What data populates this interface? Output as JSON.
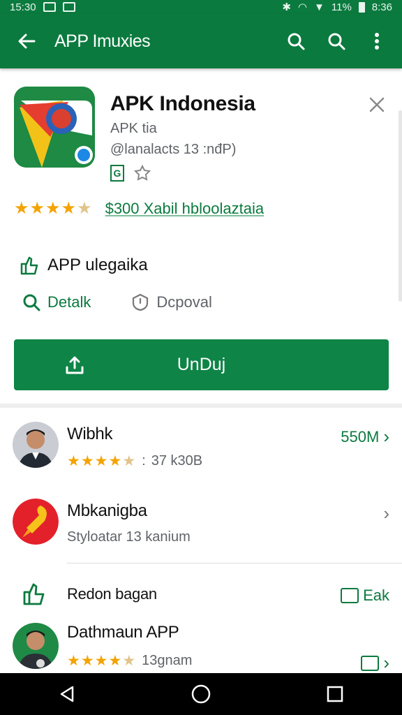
{
  "status_bar": {
    "time": "15:30",
    "battery": "11%",
    "clock_right": "8:36"
  },
  "app_bar": {
    "title": "APP Imuxies"
  },
  "app": {
    "name": "APK Indonesia",
    "developer": "APK tia",
    "meta": "@lanalacts 13 :nđP)",
    "rating_stars": 4,
    "price_text": "$300 Xabil hbloolaztaia",
    "feature_text": "APP ulegaika",
    "detail_link": "Detalk",
    "report_link": "Dcpoval",
    "install_label": "UnDuj"
  },
  "list": {
    "items": [
      {
        "title": "Wibhk",
        "sub": "37 k30B",
        "stars": 4.5,
        "right": "550M"
      },
      {
        "title": "Mbkanigba",
        "sub": "Styloatar 13 kanium",
        "right": ""
      },
      {
        "title": "Redon bagan",
        "sub": "",
        "right": "Eak"
      },
      {
        "title": "Dathmaun APP",
        "sub": "13gnam",
        "stars": 4,
        "right": ""
      }
    ]
  },
  "colors": {
    "primary": "#0b7a3f",
    "star": "#f4a300",
    "button": "#0e8446"
  }
}
